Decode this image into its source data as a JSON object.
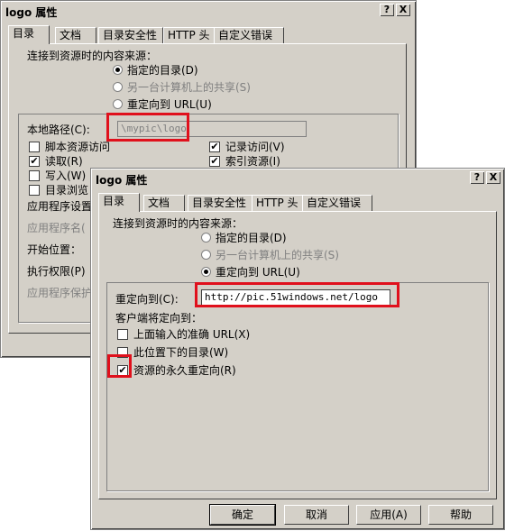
{
  "back": {
    "title": "logo 属性",
    "help_btn": "?",
    "close_btn": "X",
    "tabs": [
      "目录",
      "文档",
      "目录安全性",
      "HTTP 头",
      "自定义错误"
    ],
    "source_heading": "连接到资源时的内容来源：",
    "radio": [
      "指定的目录(D)",
      "另一台计算机上的共享(S)",
      "重定向到 URL(U)"
    ],
    "local_path_label": "本地路径(C):",
    "local_path_value": "\\mypic\\logo",
    "checks_left": [
      "脚本资源访问",
      "读取(R)",
      "写入(W)",
      "目录浏览"
    ],
    "checks_right": [
      "记录访问(V)",
      "索引资源(I)"
    ],
    "app_settings": "应用程序设置",
    "app_name": "应用程序名(",
    "start_pos": "开始位置：",
    "exec_perm": "执行权限(P)",
    "app_protect": "应用程序保护"
  },
  "front": {
    "title": "logo 属性",
    "help_btn": "?",
    "close_btn": "X",
    "tabs": [
      "目录",
      "文档",
      "目录安全性",
      "HTTP 头",
      "自定义错误"
    ],
    "source_heading": "连接到资源时的内容来源：",
    "radio": [
      "指定的目录(D)",
      "另一台计算机上的共享(S)",
      "重定向到 URL(U)"
    ],
    "redirect_label": "重定向到(C):",
    "redirect_value": "http://pic.51windows.net/logo",
    "client_heading": "客户端将定向到：",
    "checks": [
      "上面输入的准确 URL(X)",
      "此位置下的目录(W)",
      "资源的永久重定向(R)"
    ],
    "buttons": [
      "确定",
      "取消",
      "应用(A)",
      "帮助"
    ]
  }
}
